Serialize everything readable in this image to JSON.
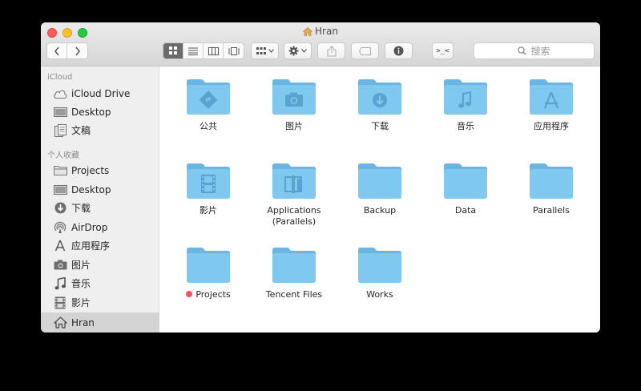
{
  "window": {
    "title": "Hran"
  },
  "toolbar": {
    "search_placeholder": "搜索",
    "terminal_label": ">_<"
  },
  "sidebar": {
    "sections": [
      {
        "header": "iCloud",
        "items": [
          {
            "label": "iCloud Drive",
            "icon": "cloud-icon"
          },
          {
            "label": "Desktop",
            "icon": "desktop-icon"
          },
          {
            "label": "文稿",
            "icon": "documents-icon"
          }
        ]
      },
      {
        "header": "个人收藏",
        "items": [
          {
            "label": "Projects",
            "icon": "folder-icon"
          },
          {
            "label": "Desktop",
            "icon": "desktop-icon"
          },
          {
            "label": "下载",
            "icon": "download-icon"
          },
          {
            "label": "AirDrop",
            "icon": "airdrop-icon"
          },
          {
            "label": "应用程序",
            "icon": "applications-icon"
          },
          {
            "label": "图片",
            "icon": "camera-icon"
          },
          {
            "label": "音乐",
            "icon": "music-icon"
          },
          {
            "label": "影片",
            "icon": "film-icon"
          },
          {
            "label": "Hran",
            "icon": "home-icon",
            "selected": true
          }
        ]
      }
    ]
  },
  "files": [
    {
      "name": "公共",
      "glyph": "public"
    },
    {
      "name": "图片",
      "glyph": "camera"
    },
    {
      "name": "下载",
      "glyph": "download"
    },
    {
      "name": "音乐",
      "glyph": "music"
    },
    {
      "name": "应用程序",
      "glyph": "apps"
    },
    {
      "name": "影片",
      "glyph": "film"
    },
    {
      "name": "Applications (Parallels)",
      "glyph": "parallels-apps"
    },
    {
      "name": "Backup",
      "glyph": "none"
    },
    {
      "name": "Data",
      "glyph": "none"
    },
    {
      "name": "Parallels",
      "glyph": "none"
    },
    {
      "name": "Projects",
      "glyph": "none",
      "tag_color": "#f2545b"
    },
    {
      "name": "Tencent Files",
      "glyph": "none"
    },
    {
      "name": "Works",
      "glyph": "none"
    }
  ],
  "colors": {
    "folder_front": "#7fc8f0",
    "folder_back": "#6bb5e0",
    "folder_glyph": "#5aa2cf",
    "tag_red": "#f2545b"
  }
}
